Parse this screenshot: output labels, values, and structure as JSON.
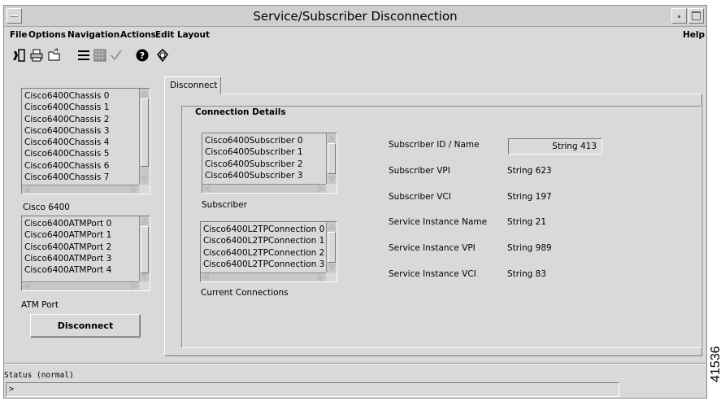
{
  "window": {
    "title": "Service/Subscriber Disconnection"
  },
  "menubar": {
    "items": [
      {
        "label": "File"
      },
      {
        "label": "Options"
      },
      {
        "label": "Navigation"
      },
      {
        "label": "Actions"
      },
      {
        "label": "Edit Layout"
      }
    ],
    "help": "Help"
  },
  "toolbar": {
    "icons": [
      "exit-icon",
      "print-icon",
      "open-icon",
      "list-icon",
      "grid-icon",
      "check-icon",
      "help-icon",
      "refresh-icon"
    ]
  },
  "left_panel": {
    "chassis_list": [
      "Cisco6400Chassis 0",
      "Cisco6400Chassis 1",
      "Cisco6400Chassis 2",
      "Cisco6400Chassis 3",
      "Cisco6400Chassis 4",
      "Cisco6400Chassis 5",
      "Cisco6400Chassis 6",
      "Cisco6400Chassis 7"
    ],
    "chassis_label": "Cisco 6400",
    "atmport_list": [
      "Cisco6400ATMPort 0",
      "Cisco6400ATMPort 1",
      "Cisco6400ATMPort 2",
      "Cisco6400ATMPort 3",
      "Cisco6400ATMPort 4"
    ],
    "atmport_label": "ATM Port",
    "disconnect_button": "Disconnect"
  },
  "tab": {
    "label": "Disconnect"
  },
  "connection_details": {
    "title": "Connection Details",
    "subscriber_list": [
      "Cisco6400Subscriber 0",
      "Cisco6400Subscriber 1",
      "Cisco6400Subscriber 2",
      "Cisco6400Subscriber 3"
    ],
    "subscriber_label": "Subscriber",
    "connections_list": [
      "Cisco6400L2TPConnection 0",
      "Cisco6400L2TPConnection 1",
      "Cisco6400L2TPConnection 2",
      "Cisco6400L2TPConnection 3"
    ],
    "connections_label": "Current Connections",
    "fields": [
      {
        "label": "Subscriber ID / Name",
        "value": "String 413"
      },
      {
        "label": "Subscriber VPI",
        "value": "String 623"
      },
      {
        "label": "Subscriber VCI",
        "value": "String 197"
      },
      {
        "label": "Service Instance Name",
        "value": "String 21"
      },
      {
        "label": "Service Instance VPI",
        "value": "String 989"
      },
      {
        "label": "Service Instance VCI",
        "value": "String 83"
      }
    ]
  },
  "status": {
    "label": "Status (normal)",
    "prompt": ">"
  },
  "figure_number": "41536"
}
